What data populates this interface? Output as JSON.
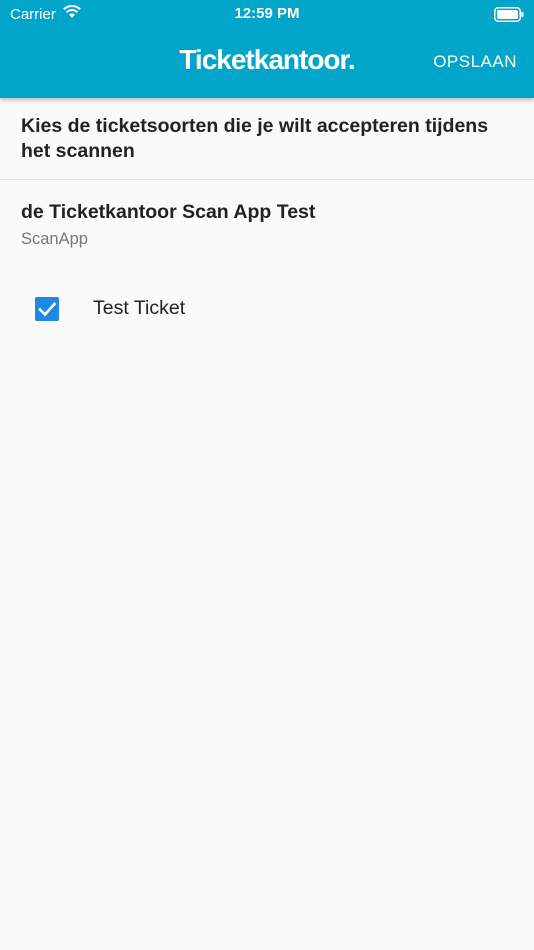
{
  "status": {
    "carrier": "Carrier",
    "time": "12:59 PM"
  },
  "header": {
    "logo_text": "Ticketkantoor.",
    "save_label": "OPSLAAN",
    "background": "#02a5ca"
  },
  "main": {
    "instruction": "Kies de ticketsoorten die je wilt accepteren tijdens het scannen",
    "event": {
      "title": "de Ticketkantoor Scan App Test",
      "subtitle": "ScanApp",
      "tickets": [
        {
          "label": "Test Ticket",
          "checked": true,
          "checkbox_color": "#1e88e5"
        }
      ]
    }
  }
}
